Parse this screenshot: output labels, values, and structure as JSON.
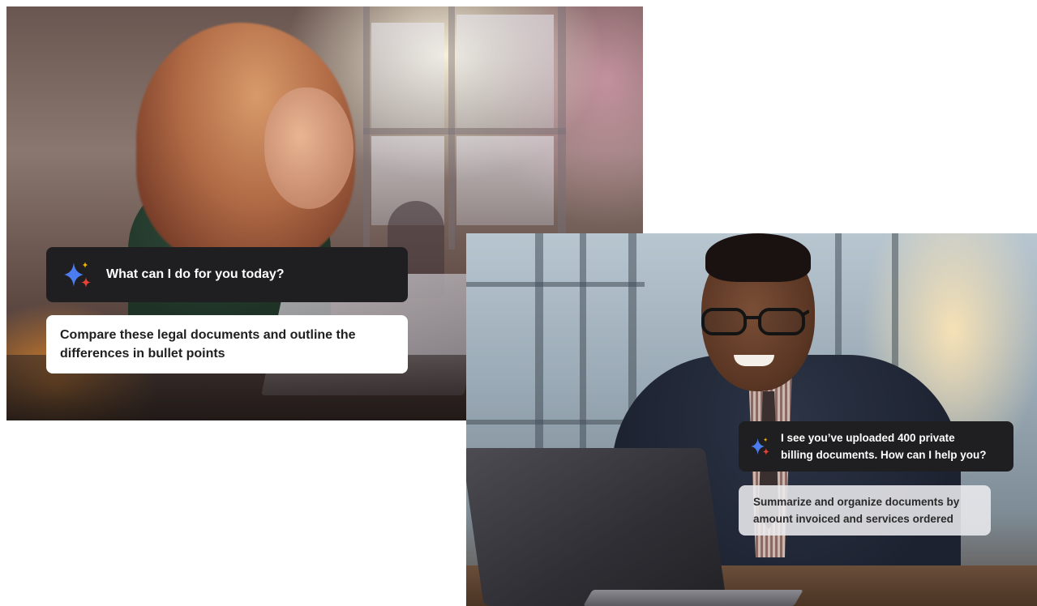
{
  "colors": {
    "sparkle_blue": "#4c7df0",
    "sparkle_red": "#e94235",
    "sparkle_yellow": "#f5b400",
    "bubble_dark": "#1f1f21",
    "bubble_light": "#ffffff"
  },
  "left_card": {
    "ai_icon": "sparkle-icon",
    "ai_prompt": "What can I do for you today?",
    "user_message": "Compare these legal documents and outline the\ndifferences in bullet points"
  },
  "right_card": {
    "ai_icon": "sparkle-icon",
    "ai_prompt": "I see you’ve uploaded 400 private\nbilling documents. How can I help you?",
    "user_message": "Summarize and organize documents by\namount invoiced and services ordered"
  }
}
